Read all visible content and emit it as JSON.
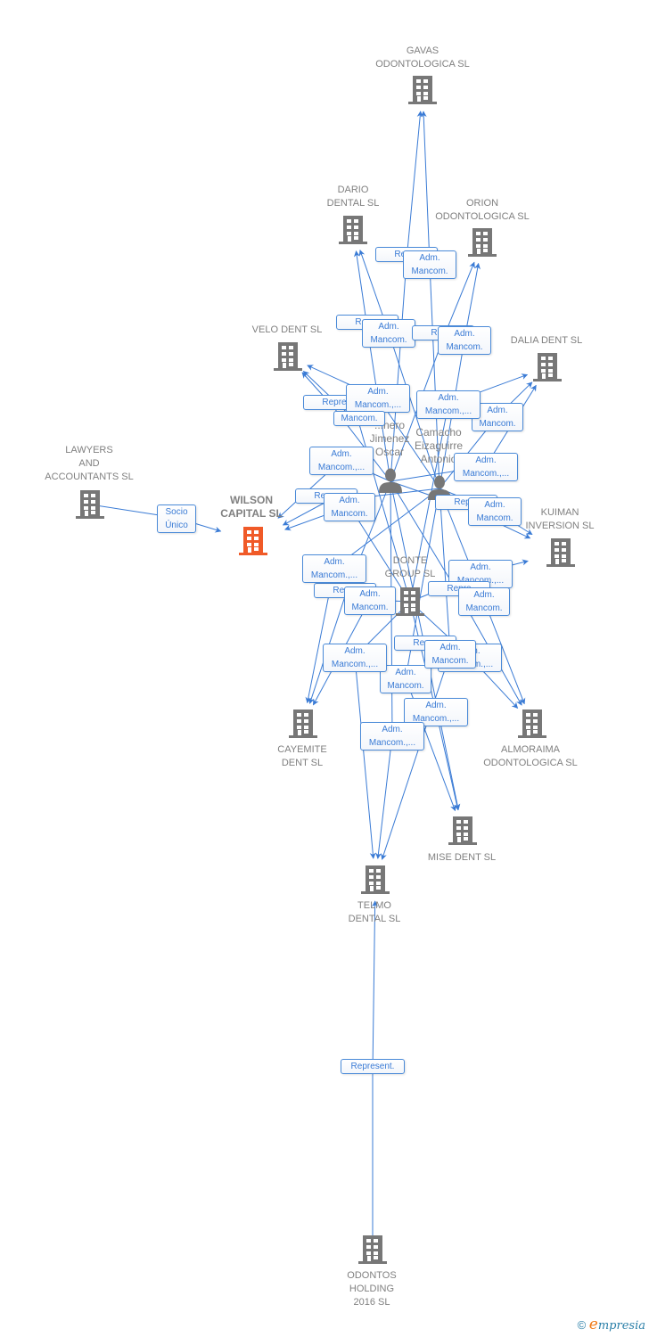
{
  "colors": {
    "edge": "#3a7bd5",
    "company_icon": "#777777",
    "focus_icon": "#f05a28",
    "person_icon": "#777777",
    "label": "#808080"
  },
  "nodes": [
    {
      "id": "gavas",
      "type": "company",
      "label": "GAVAS\nODONTOLOGICA SL"
    },
    {
      "id": "dario",
      "type": "company",
      "label": "DARIO\nDENTAL SL"
    },
    {
      "id": "orion",
      "type": "company",
      "label": "ORION\nODONTOLOGICA SL"
    },
    {
      "id": "velo",
      "type": "company",
      "label": "VELO DENT SL"
    },
    {
      "id": "dalia",
      "type": "company",
      "label": "DALIA DENT SL"
    },
    {
      "id": "lawyers",
      "type": "company",
      "label": "LAWYERS\nAND\nACCOUNTANTS SL"
    },
    {
      "id": "wilson",
      "type": "company-focus",
      "label": "WILSON\nCAPITAL  SL"
    },
    {
      "id": "kuiman",
      "type": "company",
      "label": "KUIMAN\nINVERSION SL"
    },
    {
      "id": "donte",
      "type": "company",
      "label": "DONTE\nGROUP  SL"
    },
    {
      "id": "cayemite",
      "type": "company",
      "label": "CAYEMITE\nDENT SL"
    },
    {
      "id": "almoraima",
      "type": "company",
      "label": "ALMORAIMA\nODONTOLOGICA SL"
    },
    {
      "id": "mise",
      "type": "company",
      "label": "MISE DENT SL"
    },
    {
      "id": "telmo",
      "type": "company",
      "label": "TELMO\nDENTAL SL"
    },
    {
      "id": "odontos",
      "type": "company",
      "label": "ODONTOS\nHOLDING\n2016  SL"
    },
    {
      "id": "romero",
      "type": "person",
      "label": "...nero\nJimenez\nOscar"
    },
    {
      "id": "camacho",
      "type": "person",
      "label": "Camacho\nEizaguirre\nAntonio"
    }
  ],
  "edge_labels": {
    "represent": "Represent.",
    "repre": "Repre",
    "adm_mancom": "Adm.\nMancom.",
    "adm_mancom_more": "Adm.\nMancom.,...",
    "mancom": "Mancom.",
    "socio_unico": "Socio\nÚnico"
  },
  "edges": [
    {
      "from": "lawyers",
      "to": "wilson",
      "label": "Socio\nÚnico"
    },
    {
      "from": "odontos",
      "to": "telmo",
      "label": "Represent."
    },
    {
      "from": "romero",
      "to": "gavas",
      "label": "Repre"
    },
    {
      "from": "camacho",
      "to": "gavas",
      "label": "Adm.\nMancom."
    },
    {
      "from": "romero",
      "to": "dario",
      "label": "Repre"
    },
    {
      "from": "camacho",
      "to": "dario",
      "label": "Adm.\nMancom."
    },
    {
      "from": "romero",
      "to": "orion",
      "label": "Repre"
    },
    {
      "from": "camacho",
      "to": "orion",
      "label": "Adm.\nMancom."
    },
    {
      "from": "romero",
      "to": "velo",
      "label": "Repre"
    },
    {
      "from": "camacho",
      "to": "velo",
      "label": "Adm.\nMancom.,..."
    },
    {
      "from": "donte",
      "to": "velo",
      "label": "Mancom."
    },
    {
      "from": "romero",
      "to": "dalia",
      "label": "Adm.\nMancom.,..."
    },
    {
      "from": "camacho",
      "to": "dalia",
      "label": "Adm.\nMancom."
    },
    {
      "from": "donte",
      "to": "dalia",
      "label": "Adm.\nMancom.,..."
    },
    {
      "from": "romero",
      "to": "wilson",
      "label": "Adm.\nMancom.,..."
    },
    {
      "from": "camacho",
      "to": "wilson",
      "label": "Repre"
    },
    {
      "from": "donte",
      "to": "wilson",
      "label": "Adm.\nMancom."
    },
    {
      "from": "romero",
      "to": "kuiman",
      "label": "Repre"
    },
    {
      "from": "camacho",
      "to": "kuiman",
      "label": "Adm.\nMancom."
    },
    {
      "from": "donte",
      "to": "kuiman",
      "label": "Adm.\nMancom.,..."
    },
    {
      "from": "romero",
      "to": "cayemite",
      "label": "Repre"
    },
    {
      "from": "camacho",
      "to": "cayemite",
      "label": "Adm.\nMancom.,..."
    },
    {
      "from": "donte",
      "to": "cayemite",
      "label": "Adm.\nMancom."
    },
    {
      "from": "romero",
      "to": "almoraima",
      "label": "Repre"
    },
    {
      "from": "camacho",
      "to": "almoraima",
      "label": "Adm.\nMancom."
    },
    {
      "from": "donte",
      "to": "almoraima",
      "label": "Adm.\nMancom.,..."
    },
    {
      "from": "romero",
      "to": "mise",
      "label": "Repre"
    },
    {
      "from": "camacho",
      "to": "mise",
      "label": "Adm.\nMancom."
    },
    {
      "from": "donte",
      "to": "mise",
      "label": "Adm.\nMancom.,..."
    },
    {
      "from": "romero",
      "to": "telmo",
      "label": "Adm.\nMancom.,..."
    },
    {
      "from": "camacho",
      "to": "telmo",
      "label": "Adm.\nMancom."
    },
    {
      "from": "donte",
      "to": "telmo",
      "label": "Adm.\nMancom.,..."
    }
  ],
  "footer": {
    "copyright": "©",
    "brand_initial": "e",
    "brand_rest": "mpresia"
  }
}
